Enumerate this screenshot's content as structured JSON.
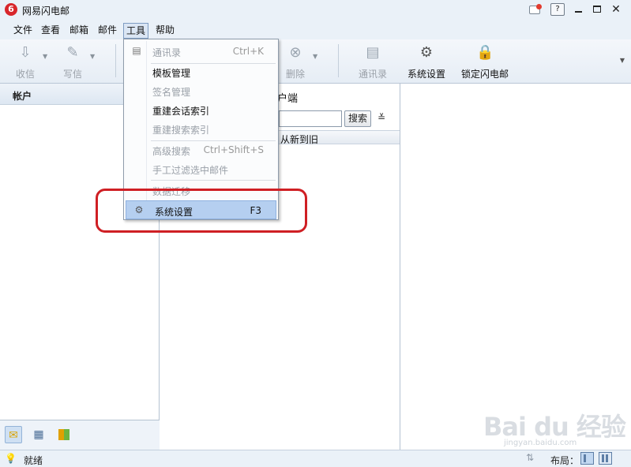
{
  "window": {
    "title": "网易闪电邮",
    "logo_glyph": "6"
  },
  "menubar": {
    "items": [
      "文件",
      "查看",
      "邮箱",
      "邮件",
      "工具",
      "帮助"
    ]
  },
  "toolbar": {
    "receive": "收信",
    "compose": "写信",
    "delete": "删除",
    "contacts": "通讯录",
    "settings": "系统设置",
    "lock": "锁定闪电邮"
  },
  "left_pane": {
    "header": "帐户"
  },
  "mid_pane": {
    "title_fragment": "户端",
    "search_button": "搜索",
    "sort_label": "从新到旧"
  },
  "tools_menu": {
    "contacts": {
      "label": "通讯录",
      "shortcut": "Ctrl+K"
    },
    "template_manage": "模板管理",
    "signature_manage": "签名管理",
    "rebuild_conversation": "重建会话索引",
    "rebuild_search": "重建搜索索引",
    "advanced_search": {
      "label": "高级搜索",
      "shortcut": "Ctrl+Shift+S"
    },
    "manual_filter": "手工过滤选中邮件",
    "data_migration": "数据迁移",
    "system_settings": {
      "label": "系统设置",
      "shortcut": "F3"
    }
  },
  "statusbar": {
    "status": "就绪",
    "layout_label": "布局："
  },
  "watermark": {
    "logo": "Bai du 经验",
    "sub": "jingyan.baidu.com"
  },
  "colors": {
    "highlight_ring": "#cf1f24",
    "menu_highlight": "#b5cff0",
    "chrome": "#eaf1f8"
  }
}
